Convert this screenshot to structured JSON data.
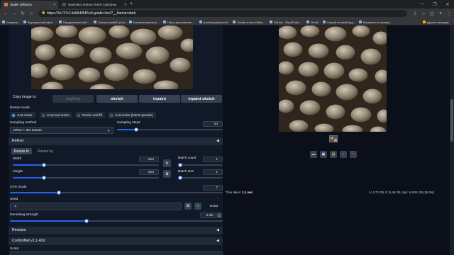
{
  "browser": {
    "tabs": [
      {
        "title": "Stable Diffusion",
        "favicon_color": "#e07b39",
        "active": true
      },
      {
        "title": "Seamless texture check | рисунок",
        "favicon_color": "#4b5563",
        "active": false
      }
    ],
    "new_tab": "+",
    "window_buttons": [
      "—",
      "❐",
      "✕"
    ],
    "url": "https://3e737c14e66d0581e9.gradio.live/?__theme=dark",
    "bookmarks": [
      "Сервисы",
      "Виртуальный офис",
      "Продвижение веб...",
      "Скачать файлЕ (Live...",
      "Космическая прог...",
      "Наше дополнение...",
      "practice python.pdf",
      "Create a new Kibble...",
      "GitHub - StackPubli...",
      "Gmail",
      "Самый полный выд...",
      "Вакансии по компер..."
    ],
    "other_bookmarks": "Другие закладки"
  },
  "left": {
    "copy_image_to_label": "Copy image to:",
    "copy_buttons": [
      "img2img",
      "sketch",
      "inpaint",
      "inpaint sketch"
    ],
    "resize_mode_label": "Resize mode",
    "resize_modes": [
      "Just resize",
      "Crop and resize",
      "Resize and fill",
      "Just resize (latent upscale)"
    ],
    "sampling_method_label": "Sampling method",
    "sampling_method_value": "DPM++ 2M Karras",
    "sampling_steps_label": "Sampling steps",
    "sampling_steps_value": "24",
    "refiner_label": "Refiner",
    "resize_tabs": [
      "Resize to",
      "Resize by"
    ],
    "width_label": "Width",
    "width_value": "512",
    "height_label": "Height",
    "height_value": "512",
    "batch_count_label": "Batch count",
    "batch_count_value": "1",
    "batch_size_label": "Batch size",
    "batch_size_value": "1",
    "cfg_label": "CFG Scale",
    "cfg_value": "7",
    "seed_label": "Seed",
    "seed_value": "-1",
    "extra_label": "Extra",
    "denoise_label": "Denoising strength",
    "denoise_value": "0,35",
    "revision_label": "Revision",
    "controlnet_label": "ControlNet v1.1.419",
    "script_label": "Script",
    "sliders": {
      "sampling_steps": 0.16,
      "width": 0.2,
      "height": 0.2,
      "cfg": 0.22,
      "denoise": 0.35,
      "batch_count": 0.0,
      "batch_size": 0.0
    }
  },
  "right": {
    "tool_icons": [
      "folder-icon",
      "save-icon",
      "zip-icon",
      "palette-icon",
      "send-icon"
    ],
    "time_taken_label": "Time taken:",
    "time_taken_value": "1.1 sec.",
    "stats": "A: 4.72 GB, R: 5.48 GB, Sys: 6.3/24 GB (26.3%)"
  }
}
